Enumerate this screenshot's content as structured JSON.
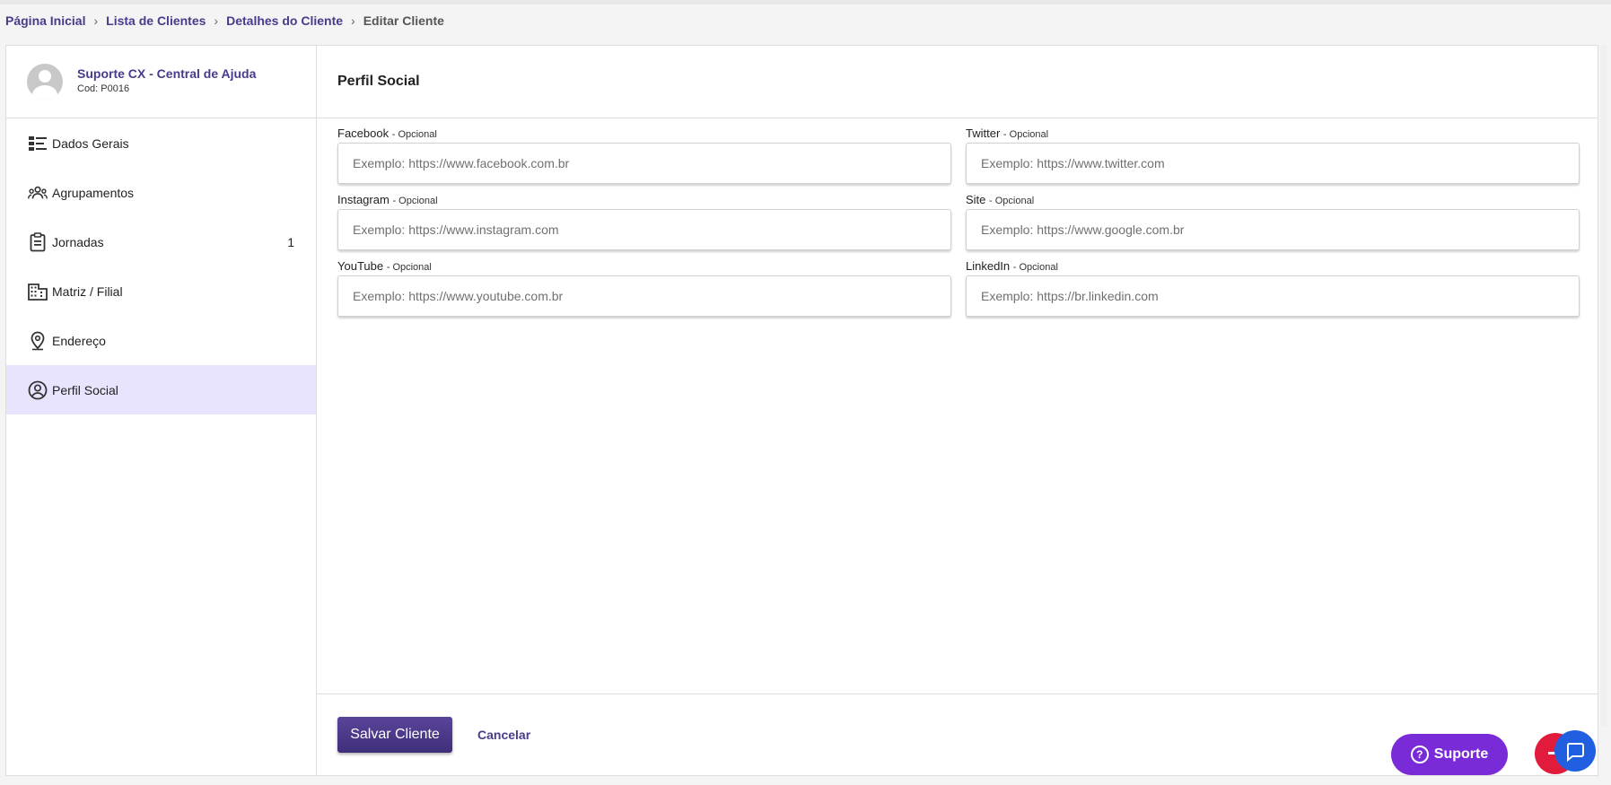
{
  "breadcrumb": {
    "items": [
      "Página Inicial",
      "Lista de Clientes",
      "Detalhes do Cliente"
    ],
    "current": "Editar Cliente",
    "separator": "›"
  },
  "client": {
    "name": "Suporte CX - Central de Ajuda",
    "code": "Cod: P0016"
  },
  "sidebar": {
    "items": [
      {
        "label": "Dados Gerais",
        "icon": "list-icon"
      },
      {
        "label": "Agrupamentos",
        "icon": "group-icon"
      },
      {
        "label": "Jornadas",
        "icon": "clipboard-icon",
        "count": "1"
      },
      {
        "label": "Matriz / Filial",
        "icon": "building-icon"
      },
      {
        "label": "Endereço",
        "icon": "location-pin-icon"
      },
      {
        "label": "Perfil Social",
        "icon": "account-circle-icon",
        "active": true
      }
    ]
  },
  "content": {
    "title": "Perfil Social",
    "optional_suffix": "- Opcional",
    "fields": {
      "facebook": {
        "label": "Facebook",
        "placeholder": "Exemplo: https://www.facebook.com.br"
      },
      "twitter": {
        "label": "Twitter",
        "placeholder": "Exemplo: https://www.twitter.com"
      },
      "instagram": {
        "label": "Instagram",
        "placeholder": "Exemplo: https://www.instagram.com"
      },
      "site": {
        "label": "Site",
        "placeholder": "Exemplo: https://www.google.com.br"
      },
      "youtube": {
        "label": "YouTube",
        "placeholder": "Exemplo: https://www.youtube.com.br"
      },
      "linkedin": {
        "label": "LinkedIn",
        "placeholder": "Exemplo: https://br.linkedin.com"
      }
    }
  },
  "footer": {
    "save_label": "Salvar Cliente",
    "cancel_label": "Cancelar"
  },
  "widgets": {
    "support_label": "Suporte"
  },
  "colors": {
    "brand": "#4a3a8c",
    "active_bg": "#e8e4fd",
    "support": "#7a2bd8",
    "chat": "#1f5fe0",
    "alert": "#e01b3c"
  }
}
